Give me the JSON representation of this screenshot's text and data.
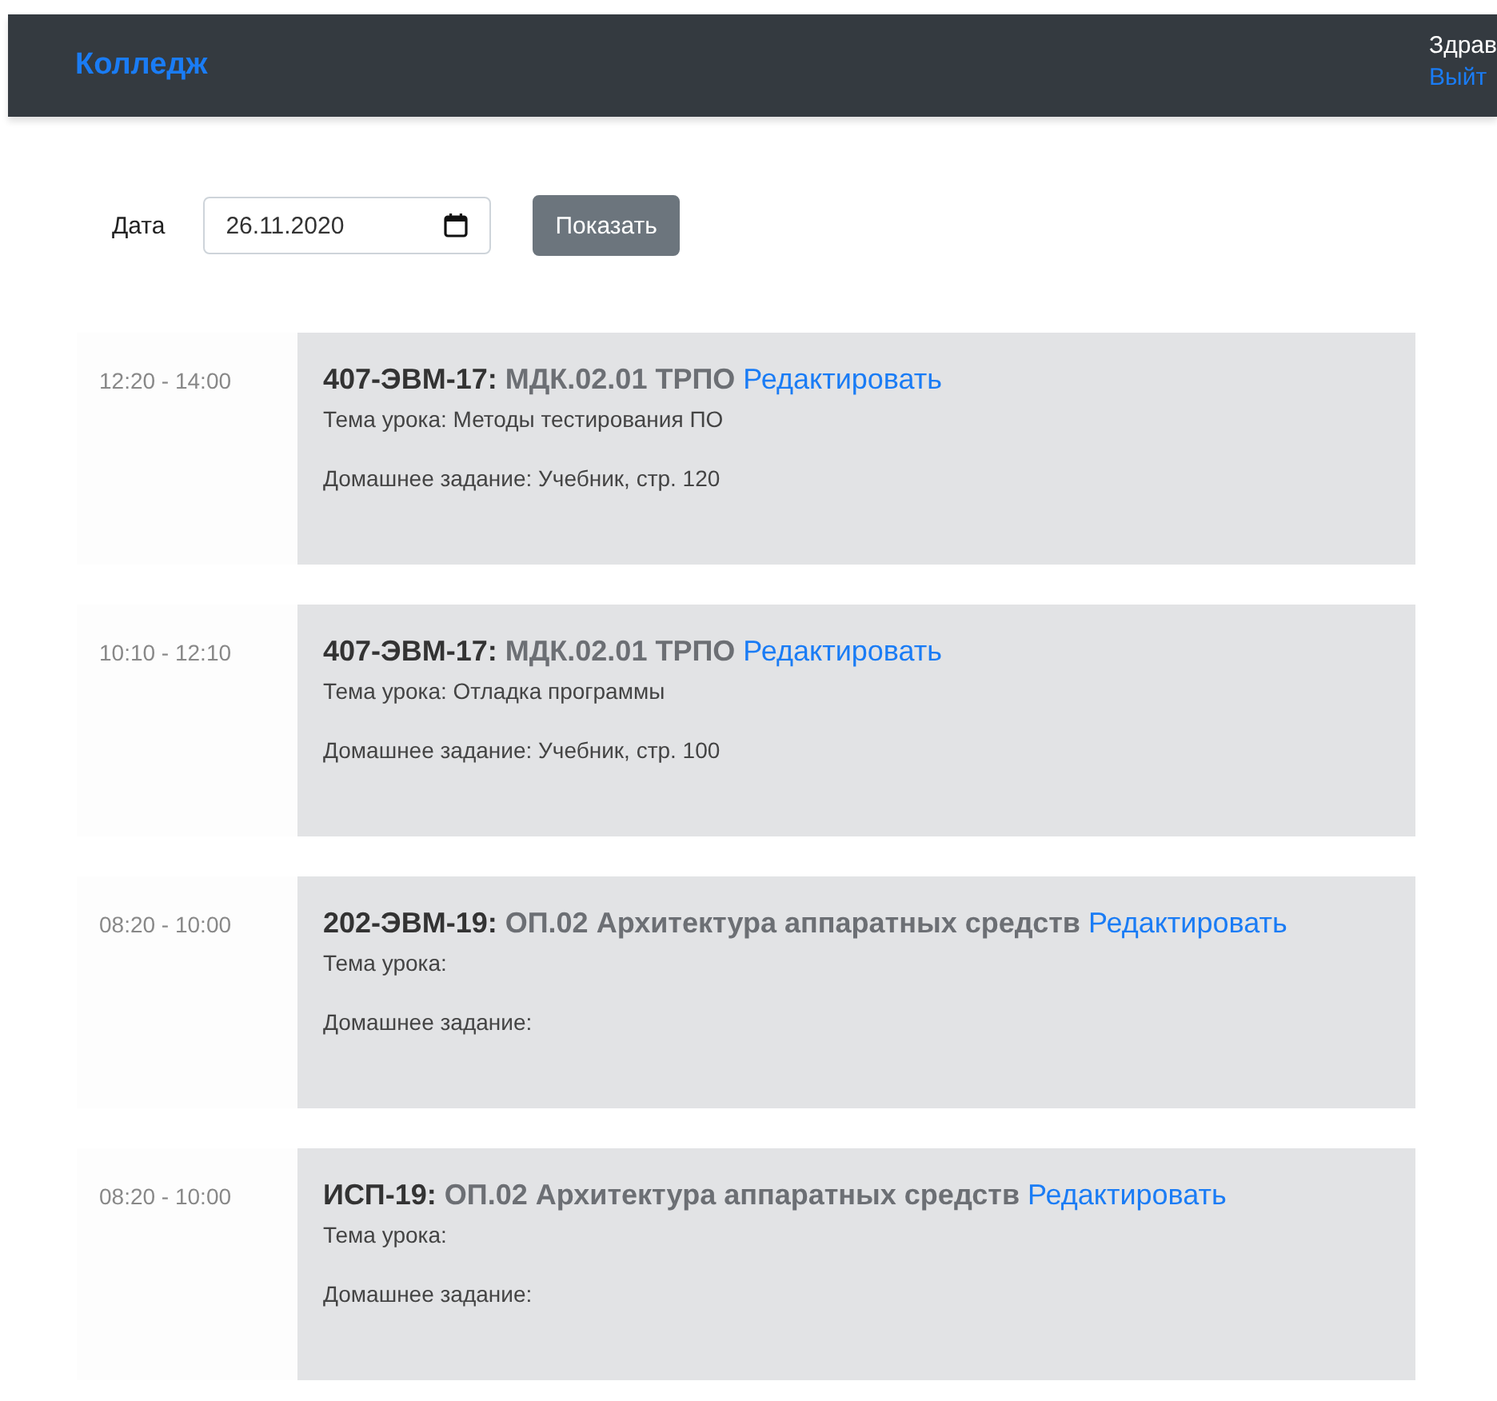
{
  "navbar": {
    "brand": "Колледж",
    "greeting": "Здрав",
    "logout": "Выйт"
  },
  "filter": {
    "label": "Дата",
    "date": "26.11.2020",
    "button": "Показать"
  },
  "lessons": [
    {
      "time": "12:20 - 14:00",
      "group": "407-ЭВМ-17:",
      "subject": "МДК.02.01 ТРПО",
      "edit": "Редактировать",
      "topic": "Тема урока: Методы тестирования ПО",
      "homework": "Домашнее задание: Учебник, стр. 120"
    },
    {
      "time": "10:10 - 12:10",
      "group": "407-ЭВМ-17:",
      "subject": "МДК.02.01 ТРПО",
      "edit": "Редактировать",
      "topic": "Тема урока: Отладка программы",
      "homework": "Домашнее задание: Учебник, стр. 100"
    },
    {
      "time": "08:20 - 10:00",
      "group": "202-ЭВМ-19:",
      "subject": "ОП.02 Архитектура аппаратных средств",
      "edit": "Редактировать",
      "topic": "Тема урока:",
      "homework": "Домашнее задание:"
    },
    {
      "time": "08:20 - 10:00",
      "group": "ИСП-19:",
      "subject": "ОП.02 Архитектура аппаратных средств",
      "edit": "Редактировать",
      "topic": "Тема урока:",
      "homework": "Домашнее задание:"
    }
  ]
}
